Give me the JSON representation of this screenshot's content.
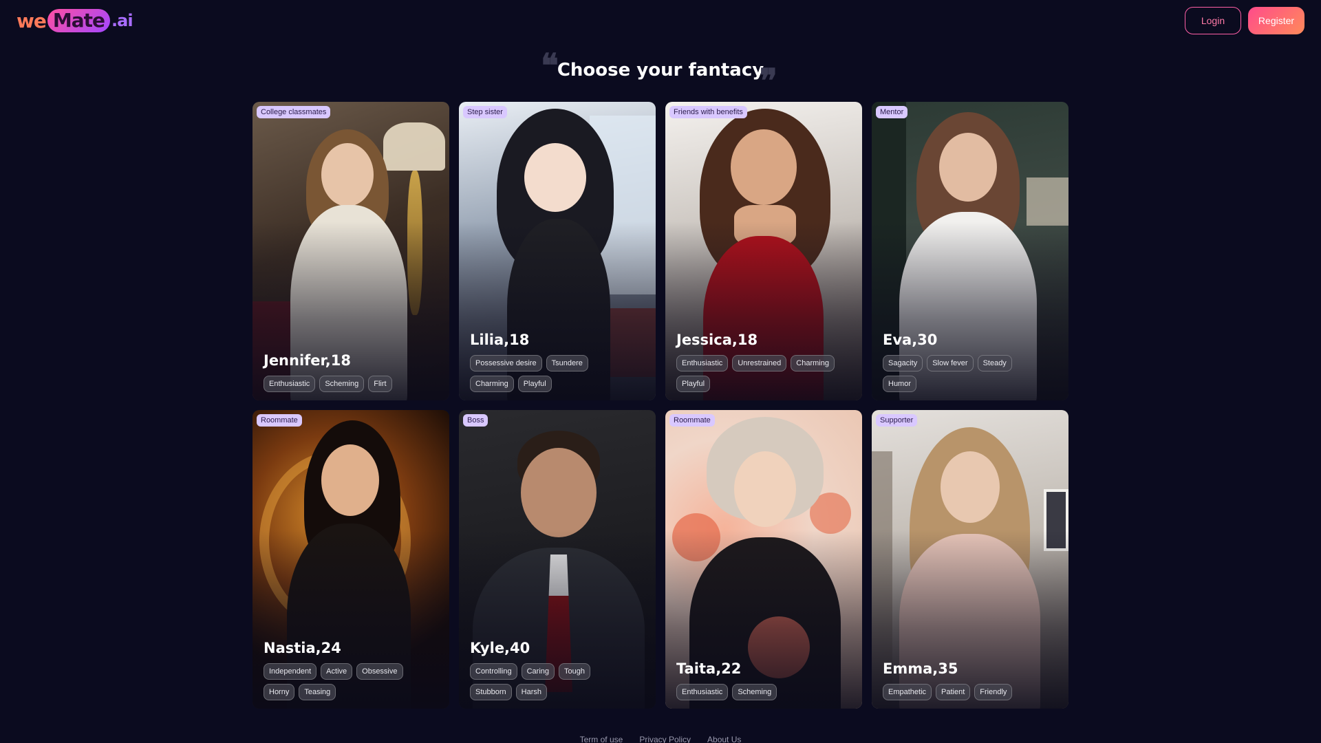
{
  "brand": {
    "we": "we",
    "mate": "Mate",
    "ai": ".ai"
  },
  "header": {
    "login_label": "Login",
    "register_label": "Register"
  },
  "title": "Choose your fantacy",
  "quote_open": "❝",
  "quote_close": "❞",
  "cards": [
    {
      "relation": "College classmates",
      "name": "Jennifer,18",
      "tags": [
        "Enthusiastic",
        "Scheming",
        "Flirt"
      ]
    },
    {
      "relation": "Step sister",
      "name": "Lilia,18",
      "tags": [
        "Possessive desire",
        "Tsundere",
        "Charming",
        "Playful"
      ]
    },
    {
      "relation": "Friends with benefits",
      "name": "Jessica,18",
      "tags": [
        "Enthusiastic",
        "Unrestrained",
        "Charming",
        "Playful"
      ]
    },
    {
      "relation": "Mentor",
      "name": "Eva,30",
      "tags": [
        "Sagacity",
        "Slow fever",
        "Steady",
        "Humor"
      ]
    },
    {
      "relation": "Roommate",
      "name": "Nastia,24",
      "tags": [
        "Independent",
        "Active",
        "Obsessive",
        "Horny",
        "Teasing"
      ]
    },
    {
      "relation": "Boss",
      "name": "Kyle,40",
      "tags": [
        "Controlling",
        "Caring",
        "Tough",
        "Stubborn",
        "Harsh"
      ]
    },
    {
      "relation": "Roommate",
      "name": "Taita,22",
      "tags": [
        "Enthusiastic",
        "Scheming"
      ]
    },
    {
      "relation": "Supporter",
      "name": "Emma,35",
      "tags": [
        "Empathetic",
        "Patient",
        "Friendly"
      ]
    }
  ],
  "footer": {
    "terms": "Term of use",
    "privacy": "Privacy Policy",
    "about": "About Us"
  },
  "colors": {
    "background": "#0b0b1f",
    "accent": "#ff4b8b",
    "tag_relation_bg": "#d9c8ff"
  }
}
